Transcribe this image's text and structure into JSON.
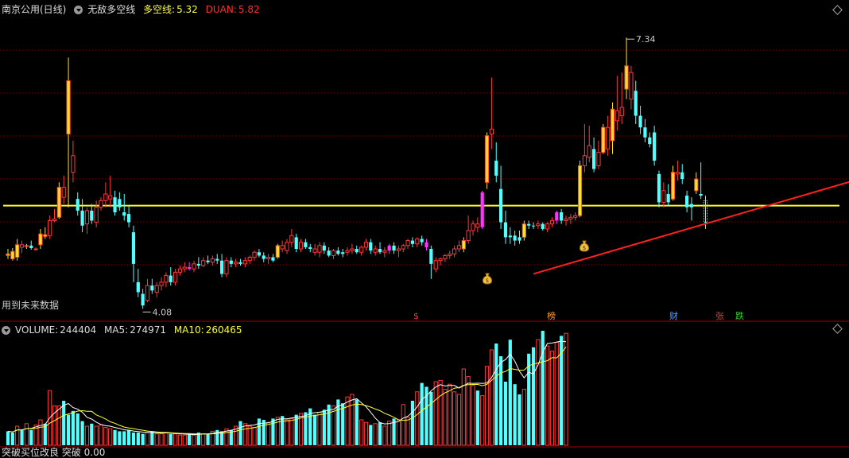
{
  "header": {
    "stock_name": "南京公用(日线)",
    "indicator_name": "无敌多空线",
    "dkx_label": "多空线:",
    "dkx_value": "5.32",
    "duan_label": "DUAN:",
    "duan_value": "5.82"
  },
  "future_data_note": "用到未来数据",
  "volume_header": {
    "volume_label": "VOLUME:",
    "volume_value": "244404",
    "ma5_label": "MA5:",
    "ma5_value": "274971",
    "ma10_label": "MA10:",
    "ma10_value": "260465"
  },
  "signal_tags": [
    {
      "text": "$",
      "color": "#ff3030"
    },
    {
      "text": "榜",
      "color": "#ff9a30"
    },
    {
      "text": "财",
      "color": "#5aa0ff"
    },
    {
      "text": "张",
      "color": "#ff3030"
    },
    {
      "text": "跌",
      "color": "#30d030"
    }
  ],
  "bottom_label": "突破买位改良 突破 0.00",
  "colors": {
    "up": "#ff3a3a",
    "down": "#54ffff",
    "yellow_line": "#ffff33",
    "trend_line": "#ff2020",
    "ma5": "#ffffff",
    "ma10": "#ffff33"
  },
  "chart_data": {
    "type": "candlestick",
    "price_ylim": [
      3.95,
      7.6
    ],
    "high_label": "7.34",
    "low_label": "4.08",
    "horizontal_line": 5.32,
    "trend_line": {
      "from_index": 113,
      "from_value": 4.5,
      "to_index": 196,
      "to_value": 5.85
    },
    "candles": [
      {
        "o": 4.74,
        "h": 4.8,
        "l": 4.68,
        "c": 4.72,
        "col": "yellow"
      },
      {
        "o": 4.77,
        "h": 4.81,
        "l": 4.66,
        "c": 4.68,
        "col": "yellow"
      },
      {
        "o": 4.7,
        "h": 4.92,
        "l": 4.66,
        "c": 4.85,
        "col": "yellow"
      },
      {
        "o": 4.85,
        "h": 4.9,
        "l": 4.75,
        "c": 4.82,
        "col": "up"
      },
      {
        "o": 4.83,
        "h": 4.86,
        "l": 4.8,
        "c": 4.84,
        "col": "yellow"
      },
      {
        "o": 4.84,
        "h": 4.9,
        "l": 4.79,
        "c": 4.81,
        "col": "down"
      },
      {
        "o": 4.8,
        "h": 4.82,
        "l": 4.78,
        "c": 4.8,
        "col": "up"
      },
      {
        "o": 4.85,
        "h": 5.04,
        "l": 4.8,
        "c": 4.98,
        "col": "yellow"
      },
      {
        "o": 4.97,
        "h": 5.06,
        "l": 4.92,
        "c": 4.95,
        "col": "yellow"
      },
      {
        "o": 4.96,
        "h": 5.2,
        "l": 4.92,
        "c": 5.14,
        "col": "up"
      },
      {
        "o": 5.14,
        "h": 5.28,
        "l": 5.12,
        "c": 5.16,
        "col": "up"
      },
      {
        "o": 5.18,
        "h": 5.6,
        "l": 5.16,
        "c": 5.54,
        "col": "yellow"
      },
      {
        "o": 5.54,
        "h": 5.68,
        "l": 5.34,
        "c": 5.42,
        "col": "up"
      },
      {
        "o": 6.82,
        "h": 7.1,
        "l": 5.3,
        "c": 6.18,
        "col": "yellow"
      },
      {
        "o": 5.92,
        "h": 6.1,
        "l": 5.6,
        "c": 5.72,
        "col": "up"
      },
      {
        "o": 5.4,
        "h": 5.48,
        "l": 5.2,
        "c": 5.26,
        "col": "down"
      },
      {
        "o": 5.26,
        "h": 5.4,
        "l": 5.0,
        "c": 5.08,
        "col": "down"
      },
      {
        "o": 5.1,
        "h": 5.3,
        "l": 4.98,
        "c": 5.26,
        "col": "up"
      },
      {
        "o": 5.26,
        "h": 5.34,
        "l": 5.1,
        "c": 5.14,
        "col": "down"
      },
      {
        "o": 5.12,
        "h": 5.38,
        "l": 5.06,
        "c": 5.3,
        "col": "up"
      },
      {
        "o": 5.3,
        "h": 5.42,
        "l": 5.26,
        "c": 5.38,
        "col": "up"
      },
      {
        "o": 5.38,
        "h": 5.6,
        "l": 5.3,
        "c": 5.46,
        "col": "up"
      },
      {
        "o": 5.4,
        "h": 5.68,
        "l": 5.3,
        "c": 5.44,
        "col": "up"
      },
      {
        "o": 5.42,
        "h": 5.5,
        "l": 5.2,
        "c": 5.24,
        "col": "down"
      },
      {
        "o": 5.4,
        "h": 5.48,
        "l": 5.26,
        "c": 5.3,
        "col": "down"
      },
      {
        "o": 5.24,
        "h": 5.46,
        "l": 5.14,
        "c": 5.2,
        "col": "down"
      },
      {
        "o": 5.22,
        "h": 5.32,
        "l": 5.06,
        "c": 5.12,
        "col": "down"
      },
      {
        "o": 5.0,
        "h": 5.08,
        "l": 4.4,
        "c": 4.62,
        "col": "down"
      },
      {
        "o": 4.4,
        "h": 4.56,
        "l": 4.22,
        "c": 4.28,
        "col": "down"
      },
      {
        "o": 4.26,
        "h": 4.32,
        "l": 4.08,
        "c": 4.12,
        "col": "down"
      },
      {
        "o": 4.18,
        "h": 4.44,
        "l": 4.16,
        "c": 4.36,
        "col": "up"
      },
      {
        "o": 4.36,
        "h": 4.44,
        "l": 4.26,
        "c": 4.3,
        "col": "down"
      },
      {
        "o": 4.28,
        "h": 4.4,
        "l": 4.22,
        "c": 4.36,
        "col": "up"
      },
      {
        "o": 4.36,
        "h": 4.46,
        "l": 4.3,
        "c": 4.4,
        "col": "up"
      },
      {
        "o": 4.4,
        "h": 4.52,
        "l": 4.34,
        "c": 4.48,
        "col": "up"
      },
      {
        "o": 4.48,
        "h": 4.58,
        "l": 4.36,
        "c": 4.4,
        "col": "down"
      },
      {
        "o": 4.4,
        "h": 4.56,
        "l": 4.36,
        "c": 4.52,
        "col": "up"
      },
      {
        "o": 4.52,
        "h": 4.6,
        "l": 4.48,
        "c": 4.56,
        "col": "up"
      },
      {
        "o": 4.56,
        "h": 4.64,
        "l": 4.52,
        "c": 4.58,
        "col": "up"
      },
      {
        "o": 4.58,
        "h": 4.64,
        "l": 4.54,
        "c": 4.56,
        "col": "magenta"
      },
      {
        "o": 4.56,
        "h": 4.66,
        "l": 4.52,
        "c": 4.62,
        "col": "up"
      },
      {
        "o": 4.62,
        "h": 4.7,
        "l": 4.56,
        "c": 4.6,
        "col": "down"
      },
      {
        "o": 4.6,
        "h": 4.7,
        "l": 4.58,
        "c": 4.66,
        "col": "up"
      },
      {
        "o": 4.66,
        "h": 4.72,
        "l": 4.62,
        "c": 4.64,
        "col": "down"
      },
      {
        "o": 4.64,
        "h": 4.72,
        "l": 4.6,
        "c": 4.68,
        "col": "up"
      },
      {
        "o": 4.68,
        "h": 4.74,
        "l": 4.62,
        "c": 4.66,
        "col": "down"
      },
      {
        "o": 4.66,
        "h": 4.74,
        "l": 4.46,
        "c": 4.5,
        "col": "down"
      },
      {
        "o": 4.5,
        "h": 4.7,
        "l": 4.46,
        "c": 4.66,
        "col": "up"
      },
      {
        "o": 4.66,
        "h": 4.7,
        "l": 4.58,
        "c": 4.62,
        "col": "down"
      },
      {
        "o": 4.62,
        "h": 4.68,
        "l": 4.58,
        "c": 4.64,
        "col": "up"
      },
      {
        "o": 4.64,
        "h": 4.68,
        "l": 4.6,
        "c": 4.62,
        "col": "down"
      },
      {
        "o": 4.62,
        "h": 4.7,
        "l": 4.58,
        "c": 4.66,
        "col": "up"
      },
      {
        "o": 4.66,
        "h": 4.72,
        "l": 4.62,
        "c": 4.7,
        "col": "up"
      },
      {
        "o": 4.7,
        "h": 4.78,
        "l": 4.66,
        "c": 4.76,
        "col": "up"
      },
      {
        "o": 4.76,
        "h": 4.8,
        "l": 4.7,
        "c": 4.72,
        "col": "down"
      },
      {
        "o": 4.72,
        "h": 4.76,
        "l": 4.64,
        "c": 4.68,
        "col": "down"
      },
      {
        "o": 4.68,
        "h": 4.74,
        "l": 4.62,
        "c": 4.7,
        "col": "up"
      },
      {
        "o": 4.7,
        "h": 4.74,
        "l": 4.64,
        "c": 4.66,
        "col": "down"
      },
      {
        "o": 4.7,
        "h": 4.86,
        "l": 4.68,
        "c": 4.84,
        "col": "yellow"
      },
      {
        "o": 4.84,
        "h": 4.9,
        "l": 4.76,
        "c": 4.8,
        "col": "up"
      },
      {
        "o": 4.78,
        "h": 4.92,
        "l": 4.74,
        "c": 4.88,
        "col": "up"
      },
      {
        "o": 4.88,
        "h": 5.04,
        "l": 4.82,
        "c": 4.96,
        "col": "up"
      },
      {
        "o": 4.94,
        "h": 4.98,
        "l": 4.76,
        "c": 4.8,
        "col": "down"
      },
      {
        "o": 4.8,
        "h": 4.92,
        "l": 4.76,
        "c": 4.88,
        "col": "up"
      },
      {
        "o": 4.88,
        "h": 4.92,
        "l": 4.8,
        "c": 4.82,
        "col": "down"
      },
      {
        "o": 4.82,
        "h": 4.86,
        "l": 4.76,
        "c": 4.8,
        "col": "down"
      },
      {
        "o": 4.8,
        "h": 4.86,
        "l": 4.72,
        "c": 4.76,
        "col": "up"
      },
      {
        "o": 4.76,
        "h": 4.88,
        "l": 4.7,
        "c": 4.84,
        "col": "up"
      },
      {
        "o": 4.84,
        "h": 4.88,
        "l": 4.74,
        "c": 4.78,
        "col": "down"
      },
      {
        "o": 4.78,
        "h": 4.82,
        "l": 4.7,
        "c": 4.72,
        "col": "down"
      },
      {
        "o": 4.72,
        "h": 4.8,
        "l": 4.68,
        "c": 4.78,
        "col": "up"
      },
      {
        "o": 4.78,
        "h": 4.82,
        "l": 4.72,
        "c": 4.74,
        "col": "down"
      },
      {
        "o": 4.74,
        "h": 4.8,
        "l": 4.7,
        "c": 4.76,
        "col": "down"
      },
      {
        "o": 4.76,
        "h": 4.82,
        "l": 4.72,
        "c": 4.78,
        "col": "up"
      },
      {
        "o": 4.78,
        "h": 4.86,
        "l": 4.74,
        "c": 4.8,
        "col": "up"
      },
      {
        "o": 4.8,
        "h": 4.84,
        "l": 4.74,
        "c": 4.76,
        "col": "down"
      },
      {
        "o": 4.76,
        "h": 4.84,
        "l": 4.72,
        "c": 4.82,
        "col": "up"
      },
      {
        "o": 4.82,
        "h": 4.92,
        "l": 4.78,
        "c": 4.88,
        "col": "up"
      },
      {
        "o": 4.88,
        "h": 4.92,
        "l": 4.74,
        "c": 4.78,
        "col": "down"
      },
      {
        "o": 4.76,
        "h": 4.84,
        "l": 4.72,
        "c": 4.8,
        "col": "up"
      },
      {
        "o": 4.8,
        "h": 4.88,
        "l": 4.74,
        "c": 4.76,
        "col": "down"
      },
      {
        "o": 4.76,
        "h": 4.82,
        "l": 4.7,
        "c": 4.78,
        "col": "up"
      },
      {
        "o": 4.78,
        "h": 4.86,
        "l": 4.74,
        "c": 4.84,
        "col": "magenta"
      },
      {
        "o": 4.84,
        "h": 4.88,
        "l": 4.74,
        "c": 4.78,
        "col": "down"
      },
      {
        "o": 4.78,
        "h": 4.84,
        "l": 4.7,
        "c": 4.8,
        "col": "up"
      },
      {
        "o": 4.8,
        "h": 4.86,
        "l": 4.76,
        "c": 4.84,
        "col": "up"
      },
      {
        "o": 4.84,
        "h": 4.92,
        "l": 4.8,
        "c": 4.9,
        "col": "up"
      },
      {
        "o": 4.9,
        "h": 4.94,
        "l": 4.82,
        "c": 4.86,
        "col": "down"
      },
      {
        "o": 4.86,
        "h": 4.94,
        "l": 4.82,
        "c": 4.92,
        "col": "up"
      },
      {
        "o": 4.92,
        "h": 4.96,
        "l": 4.84,
        "c": 4.88,
        "col": "down"
      },
      {
        "o": 4.88,
        "h": 4.92,
        "l": 4.78,
        "c": 4.82,
        "col": "magenta"
      },
      {
        "o": 4.8,
        "h": 4.84,
        "l": 4.44,
        "c": 4.62,
        "col": "down"
      },
      {
        "o": 4.56,
        "h": 4.7,
        "l": 4.52,
        "c": 4.66,
        "col": "up"
      },
      {
        "o": 4.66,
        "h": 4.7,
        "l": 4.6,
        "c": 4.68,
        "col": "up"
      },
      {
        "o": 4.68,
        "h": 4.74,
        "l": 4.64,
        "c": 4.72,
        "col": "up"
      },
      {
        "o": 4.72,
        "h": 4.78,
        "l": 4.68,
        "c": 4.74,
        "col": "up"
      },
      {
        "o": 4.74,
        "h": 4.84,
        "l": 4.7,
        "c": 4.8,
        "col": "up"
      },
      {
        "o": 4.8,
        "h": 4.9,
        "l": 4.76,
        "c": 4.84,
        "col": "up"
      },
      {
        "o": 4.8,
        "h": 4.94,
        "l": 4.76,
        "c": 4.9,
        "col": "yellow"
      },
      {
        "o": 4.9,
        "h": 5.2,
        "l": 4.86,
        "c": 5.02,
        "col": "up"
      },
      {
        "o": 5.02,
        "h": 5.14,
        "l": 4.96,
        "c": 5.1,
        "col": "up"
      },
      {
        "o": 5.1,
        "h": 5.18,
        "l": 5.0,
        "c": 5.06,
        "col": "up"
      },
      {
        "o": 5.06,
        "h": 5.5,
        "l": 5.04,
        "c": 5.48,
        "col": "magenta"
      },
      {
        "o": 5.6,
        "h": 6.2,
        "l": 5.52,
        "c": 6.16,
        "col": "yellow"
      },
      {
        "o": 6.18,
        "h": 6.86,
        "l": 6.0,
        "c": 6.24,
        "col": "up"
      },
      {
        "o": 5.86,
        "h": 6.08,
        "l": 5.6,
        "c": 5.68,
        "col": "down"
      },
      {
        "o": 5.52,
        "h": 5.8,
        "l": 5.04,
        "c": 5.12,
        "col": "down"
      },
      {
        "o": 5.12,
        "h": 5.26,
        "l": 4.86,
        "c": 4.94,
        "col": "down"
      },
      {
        "o": 4.94,
        "h": 5.06,
        "l": 4.86,
        "c": 4.96,
        "col": "down"
      },
      {
        "o": 4.96,
        "h": 5.02,
        "l": 4.84,
        "c": 4.9,
        "col": "down"
      },
      {
        "o": 4.9,
        "h": 5.02,
        "l": 4.86,
        "c": 4.94,
        "col": "down"
      },
      {
        "o": 4.94,
        "h": 5.14,
        "l": 4.9,
        "c": 5.1,
        "col": "yellow"
      },
      {
        "o": 5.1,
        "h": 5.14,
        "l": 5.04,
        "c": 5.08,
        "col": "down"
      },
      {
        "o": 5.08,
        "h": 5.12,
        "l": 5.04,
        "c": 5.08,
        "col": "down"
      },
      {
        "o": 5.08,
        "h": 5.14,
        "l": 5.04,
        "c": 5.1,
        "col": "up"
      },
      {
        "o": 5.1,
        "h": 5.12,
        "l": 5.02,
        "c": 5.04,
        "col": "down"
      },
      {
        "o": 5.04,
        "h": 5.12,
        "l": 5.0,
        "c": 5.1,
        "col": "up"
      },
      {
        "o": 5.1,
        "h": 5.18,
        "l": 5.06,
        "c": 5.14,
        "col": "up"
      },
      {
        "o": 5.14,
        "h": 5.26,
        "l": 5.1,
        "c": 5.24,
        "col": "magenta"
      },
      {
        "o": 5.24,
        "h": 5.28,
        "l": 5.1,
        "c": 5.14,
        "col": "down"
      },
      {
        "o": 5.14,
        "h": 5.2,
        "l": 5.08,
        "c": 5.16,
        "col": "up"
      },
      {
        "o": 5.16,
        "h": 5.22,
        "l": 5.1,
        "c": 5.18,
        "col": "up"
      },
      {
        "o": 5.18,
        "h": 5.24,
        "l": 5.14,
        "c": 5.2,
        "col": "up"
      },
      {
        "o": 5.2,
        "h": 5.86,
        "l": 5.18,
        "c": 5.8,
        "col": "yellow"
      },
      {
        "o": 5.8,
        "h": 6.3,
        "l": 5.72,
        "c": 5.92,
        "col": "up"
      },
      {
        "o": 5.9,
        "h": 6.28,
        "l": 5.84,
        "c": 6.04,
        "col": "up"
      },
      {
        "o": 6.0,
        "h": 6.14,
        "l": 5.72,
        "c": 5.76,
        "col": "down"
      },
      {
        "o": 5.8,
        "h": 6.1,
        "l": 5.76,
        "c": 5.96,
        "col": "up"
      },
      {
        "o": 5.96,
        "h": 6.3,
        "l": 5.94,
        "c": 6.26,
        "col": "yellow"
      },
      {
        "o": 6.26,
        "h": 6.4,
        "l": 5.92,
        "c": 6.0,
        "col": "up"
      },
      {
        "o": 6.1,
        "h": 6.56,
        "l": 5.94,
        "c": 6.48,
        "col": "yellow"
      },
      {
        "o": 6.46,
        "h": 6.88,
        "l": 6.22,
        "c": 6.34,
        "col": "up"
      },
      {
        "o": 6.4,
        "h": 6.92,
        "l": 6.3,
        "c": 6.5,
        "col": "up"
      },
      {
        "o": 6.72,
        "h": 7.34,
        "l": 6.6,
        "c": 7.0,
        "col": "yellow"
      },
      {
        "o": 6.92,
        "h": 7.0,
        "l": 6.48,
        "c": 6.6,
        "col": "up"
      },
      {
        "o": 6.7,
        "h": 6.82,
        "l": 6.3,
        "c": 6.4,
        "col": "down"
      },
      {
        "o": 6.4,
        "h": 6.52,
        "l": 6.18,
        "c": 6.26,
        "col": "down"
      },
      {
        "o": 6.26,
        "h": 6.36,
        "l": 6.08,
        "c": 6.14,
        "col": "down"
      },
      {
        "o": 6.14,
        "h": 6.2,
        "l": 6.02,
        "c": 6.06,
        "col": "down"
      },
      {
        "o": 6.2,
        "h": 6.28,
        "l": 5.8,
        "c": 5.86,
        "col": "down"
      },
      {
        "o": 5.7,
        "h": 5.74,
        "l": 5.3,
        "c": 5.36,
        "col": "down"
      },
      {
        "o": 5.36,
        "h": 5.6,
        "l": 5.3,
        "c": 5.5,
        "col": "up"
      },
      {
        "o": 5.46,
        "h": 5.58,
        "l": 5.32,
        "c": 5.36,
        "col": "down"
      },
      {
        "o": 5.4,
        "h": 5.8,
        "l": 5.38,
        "c": 5.72,
        "col": "yellow"
      },
      {
        "o": 5.72,
        "h": 5.86,
        "l": 5.62,
        "c": 5.7,
        "col": "up"
      },
      {
        "o": 5.72,
        "h": 5.82,
        "l": 5.58,
        "c": 5.64,
        "col": "down"
      },
      {
        "o": 5.44,
        "h": 5.5,
        "l": 5.24,
        "c": 5.3,
        "col": "down"
      },
      {
        "o": 5.34,
        "h": 5.42,
        "l": 5.14,
        "c": 5.3,
        "col": "down"
      },
      {
        "o": 5.5,
        "h": 5.72,
        "l": 5.46,
        "c": 5.64,
        "col": "yellow"
      },
      {
        "o": 5.46,
        "h": 5.84,
        "l": 5.4,
        "c": 5.44,
        "col": "down"
      },
      {
        "o": 5.38,
        "h": 5.44,
        "l": 5.04,
        "c": 5.12,
        "col": "outline"
      }
    ],
    "volumes": [
      22,
      20,
      30,
      25,
      34,
      24,
      32,
      40,
      34,
      86,
      62,
      62,
      70,
      48,
      54,
      50,
      38,
      30,
      34,
      30,
      32,
      28,
      26,
      24,
      22,
      22,
      24,
      20,
      20,
      18,
      20,
      22,
      18,
      18,
      20,
      18,
      18,
      16,
      16,
      18,
      16,
      20,
      18,
      18,
      22,
      24,
      22,
      26,
      24,
      30,
      38,
      34,
      30,
      28,
      42,
      40,
      36,
      42,
      44,
      46,
      40,
      42,
      48,
      50,
      52,
      58,
      48,
      52,
      56,
      64,
      62,
      72,
      66,
      76,
      80,
      72,
      40,
      36,
      32,
      34,
      36,
      30,
      38,
      42,
      40,
      64,
      44,
      70,
      84,
      98,
      92,
      84,
      100,
      102,
      88,
      96,
      84,
      80,
      120,
      108,
      94,
      86,
      78,
      124,
      150,
      160,
      140,
      100,
      166,
      96,
      80,
      88,
      144,
      154,
      166,
      180,
      156,
      148,
      162,
      172,
      176
    ],
    "ma5": [],
    "ma10": []
  }
}
